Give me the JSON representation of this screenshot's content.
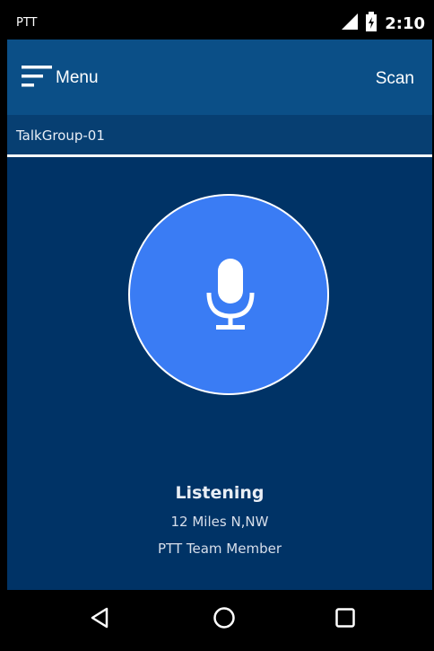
{
  "statusbar": {
    "app_label": "PTT",
    "time": "2:10",
    "signal_icon": "signal-icon",
    "battery_icon": "battery-charging-icon"
  },
  "appbar": {
    "menu_label": "Menu",
    "scan_label": "Scan",
    "menu_icon": "hamburger-menu-icon"
  },
  "talkgroup": {
    "name": "TalkGroup-01"
  },
  "ptt": {
    "icon": "microphone-icon",
    "accent": "#3a7cf4"
  },
  "status": {
    "title": "Listening",
    "distance": "12 Miles N,NW",
    "member": "PTT Team Member"
  },
  "navbar": {
    "back_icon": "back-triangle-icon",
    "home_icon": "home-circle-icon",
    "recents_icon": "recents-square-icon"
  },
  "colors": {
    "background": "#003366",
    "appbar": "#0b4f87",
    "talkgroup_bar": "#073f72",
    "button": "#3a7cf4"
  }
}
